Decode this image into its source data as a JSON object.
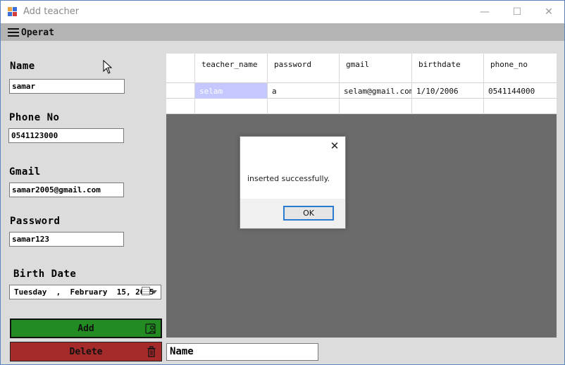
{
  "window": {
    "title": "Add teacher"
  },
  "menubar": {
    "menu_label": "Operat"
  },
  "form": {
    "name_label": "Name",
    "name_value": "samar",
    "phone_label": "Phone No",
    "phone_value": "0541123000",
    "gmail_label": "Gmail",
    "gmail_value": "samar2005@gmail.com",
    "password_label": "Password",
    "password_value": "samar123",
    "birth_label": "Birth Date",
    "birth_value": "Tuesday  ,  February  15, 2005",
    "add_label": "Add",
    "delete_label": "Delete",
    "add_button_color": "#228b22",
    "delete_button_color": "#a52a2a"
  },
  "grid": {
    "columns": [
      "teacher_name",
      "password",
      "gmail",
      "birthdate",
      "phone_no"
    ],
    "rows": [
      [
        "selam",
        "a",
        "selam@gmail.com",
        "1/10/2006",
        "0541144000"
      ]
    ]
  },
  "dialog": {
    "message": "inserted successfully.",
    "ok_label": "OK"
  },
  "bottom": {
    "search_value": "Name"
  },
  "icons": {
    "app": "app-form-icon",
    "menu": "hamburger-icon",
    "add": "add-user-icon",
    "delete": "trash-icon",
    "calendar": "calendar-icon"
  }
}
